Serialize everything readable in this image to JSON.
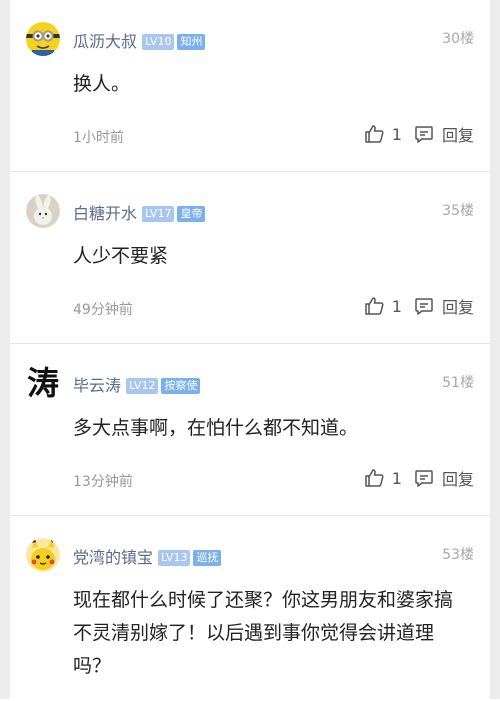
{
  "comments": [
    {
      "user": "瓜沥大叔",
      "level": "LV10",
      "title": "知州",
      "floor": "30楼",
      "text": "换人。",
      "time": "1小时前",
      "likes": "1",
      "reply": "回复",
      "avatar_icon": "minion-avatar-icon"
    },
    {
      "user": "白糖开水",
      "level": "LV17",
      "title": "皇帝",
      "floor": "35楼",
      "text": "人少不要紧",
      "time": "49分钟前",
      "likes": "1",
      "reply": "回复",
      "avatar_icon": "rabbit-avatar-icon"
    },
    {
      "user": "毕云涛",
      "level": "LV12",
      "title": "按察使",
      "floor": "51楼",
      "text": "多大点事啊，在怕什么都不知道。",
      "time": "13分钟前",
      "likes": "1",
      "reply": "回复",
      "avatar_text": "涛"
    },
    {
      "user": "党湾的镇宝",
      "level": "LV13",
      "title": "巡抚",
      "floor": "53楼",
      "text": "现在都什么时候了还聚？你这男朋友和婆家搞不灵清别嫁了！以后遇到事你觉得会讲道理吗？",
      "avatar_icon": "pikachu-avatar-icon"
    }
  ],
  "colors": {
    "username": "#5a6b8c",
    "level_badge": "#a9c6ef",
    "title_badge": "#7ab0ec",
    "edge": "#ececec"
  }
}
